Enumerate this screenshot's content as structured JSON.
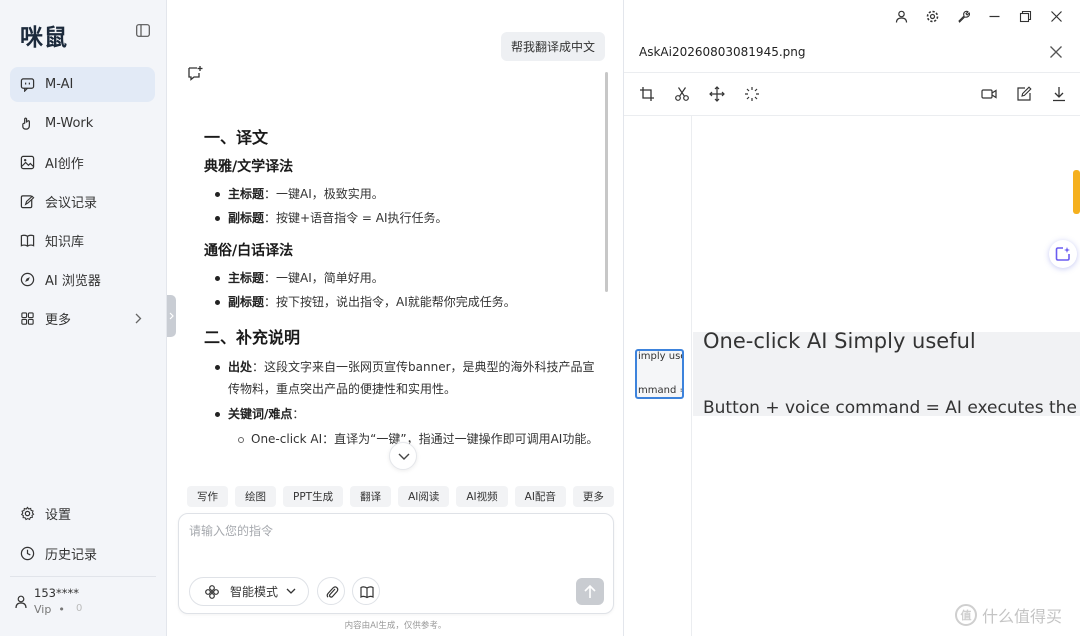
{
  "sidebar": {
    "logo": "咪鼠",
    "items": [
      {
        "label": "M-AI",
        "icon": "chat-bubble-icon",
        "active": true
      },
      {
        "label": "M-Work",
        "icon": "hand-icon"
      },
      {
        "label": "AI创作",
        "icon": "image-icon"
      },
      {
        "label": "会议记录",
        "icon": "edit-note-icon"
      },
      {
        "label": "知识库",
        "icon": "book-icon"
      },
      {
        "label": "AI 浏览器",
        "icon": "compass-icon"
      },
      {
        "label": "更多",
        "icon": "grid-icon"
      }
    ],
    "settings": "设置",
    "history": "历史记录",
    "user": {
      "name": "153****",
      "tier": "Vip",
      "extra": "0"
    }
  },
  "chat": {
    "user_message": "帮我翻译成中文",
    "answer": {
      "h1_translation": "一、译文",
      "h2_literary": "典雅/文学译法",
      "literary_main_label": "主标题",
      "literary_main_text": "：一键AI，极致实用。",
      "literary_sub_label": "副标题",
      "literary_sub_text": "：按键+语音指令 = AI执行任务。",
      "h2_plain": "通俗/白话译法",
      "plain_main_label": "主标题",
      "plain_main_text": "：一键AI，简单好用。",
      "plain_sub_label": "副标题",
      "plain_sub_text": "：按下按钮，说出指令，AI就能帮你完成任务。",
      "h1_notes": "二、补充说明",
      "source_label": "出处",
      "source_text": "：这段文字来自一张网页宣传banner，是典型的海外科技产品宣传物料，重点突出产品的便捷性和实用性。",
      "keywords_label": "关键词/难点",
      "keywords_text": "：",
      "oneclick_term": "One-click AI",
      "oneclick_text": "：直译为“一键”，指通过一键操作即可调用AI功能。"
    },
    "chips": [
      "写作",
      "绘图",
      "PPT生成",
      "翻译",
      "AI阅读",
      "AI视频",
      "AI配音",
      "更多"
    ],
    "input_placeholder": "请输入您的指令",
    "mode_label": "智能模式",
    "disclaimer": "内容由AI生成，仅供参考。"
  },
  "viewer": {
    "title": "AskAi20260803081945.png",
    "thumb_line1": "imply use",
    "thumb_line2": "mmand =",
    "preview_line1": "One-click AI  Simply useful",
    "preview_line2": "Button + voice command = AI executes the tas"
  },
  "watermark": {
    "logo": "值",
    "text": "什么值得买"
  },
  "colors": {
    "accent": "#3d83dc",
    "active_bg": "#e2eaf6",
    "sidebar_bg": "#f3f5f9",
    "orange": "#f5b01e"
  }
}
